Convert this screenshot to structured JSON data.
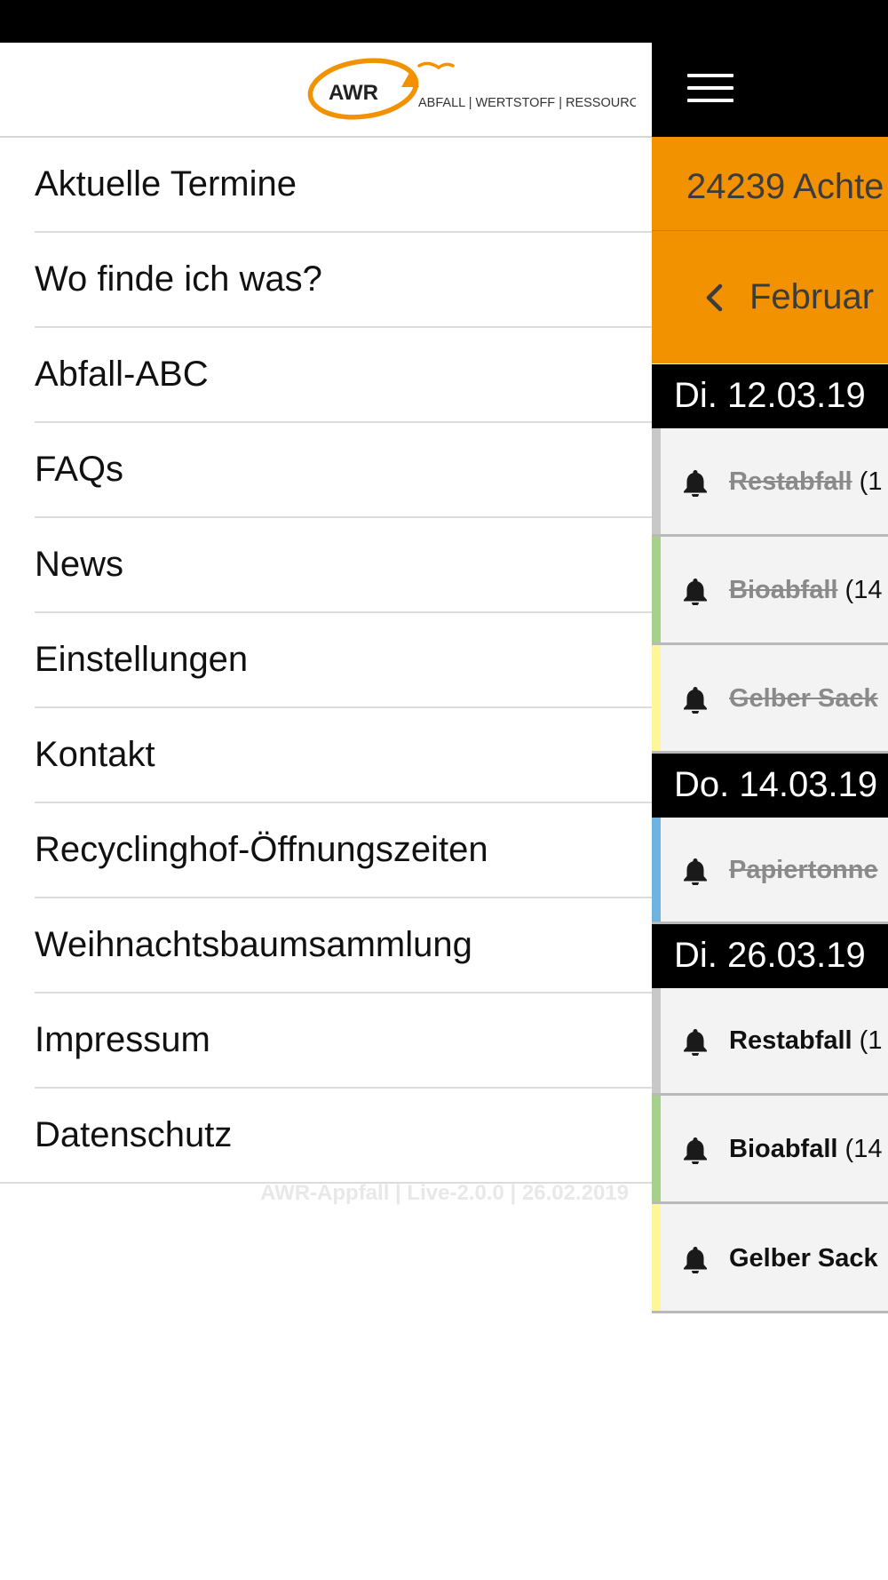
{
  "brand": {
    "logo_text": "AWR",
    "tagline": "ABFALL | WERTSTOFF | RESSOURCE",
    "accent_color": "#f39200"
  },
  "menu": {
    "items": [
      {
        "label": "Aktuelle Termine"
      },
      {
        "label": "Wo finde ich was?"
      },
      {
        "label": "Abfall-ABC"
      },
      {
        "label": "FAQs"
      },
      {
        "label": "News"
      },
      {
        "label": "Einstellungen"
      },
      {
        "label": "Kontakt"
      },
      {
        "label": "Recyclinghof-Öffnungszeiten"
      },
      {
        "label": "Weihnachtsbaumsammlung"
      },
      {
        "label": "Impressum"
      },
      {
        "label": "Datenschutz"
      }
    ],
    "version_text": "AWR-Appfall | Live-2.0.0 | 26.02.2019"
  },
  "background": {
    "menu_icon": "hamburger-menu-icon",
    "location": "24239 Achte",
    "month": "Februar",
    "month_prev_icon": "chevron-left-icon",
    "dates": [
      {
        "label": "Di. 12.03.19",
        "entries": [
          {
            "name": "Restabfall",
            "suffix": "(1",
            "done": true,
            "color": "#c8c8c8",
            "icon": "bell-icon"
          },
          {
            "name": "Bioabfall",
            "suffix": "(14",
            "done": true,
            "color": "#a8d08d",
            "icon": "bell-icon"
          },
          {
            "name": "Gelber Sack",
            "suffix": "",
            "done": true,
            "color": "#fff59a",
            "icon": "bell-icon"
          }
        ]
      },
      {
        "label": "Do. 14.03.19",
        "entries": [
          {
            "name": "Papiertonne",
            "suffix": "",
            "done": true,
            "color": "#6fb4de",
            "icon": "bell-icon"
          }
        ]
      },
      {
        "label": "Di. 26.03.19",
        "entries": [
          {
            "name": "Restabfall",
            "suffix": "(1",
            "done": false,
            "color": "#c8c8c8",
            "icon": "bell-icon"
          },
          {
            "name": "Bioabfall",
            "suffix": "(14",
            "done": false,
            "color": "#a8d08d",
            "icon": "bell-icon"
          },
          {
            "name": "Gelber Sack",
            "suffix": "",
            "done": false,
            "color": "#fff59a",
            "icon": "bell-icon"
          }
        ]
      }
    ]
  }
}
